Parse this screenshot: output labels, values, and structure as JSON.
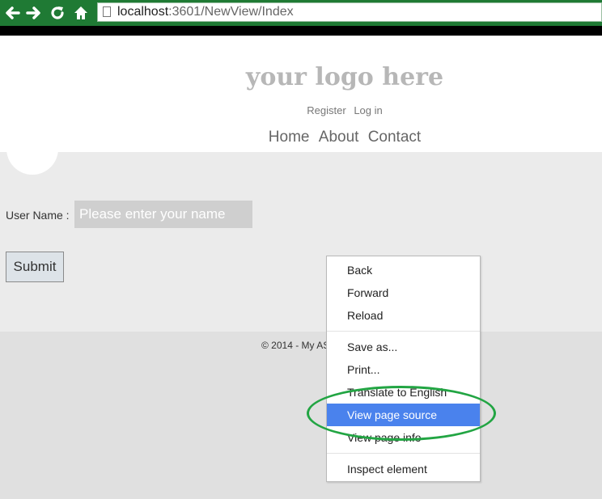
{
  "browser": {
    "address_host": "localhost",
    "address_rest": ":3601/NewView/Index",
    "icons": [
      "back-arrow-icon",
      "forward-arrow-icon",
      "reload-icon",
      "home-icon",
      "page-icon"
    ]
  },
  "header": {
    "logo": "your logo here",
    "auth": {
      "register": "Register",
      "login": "Log in"
    },
    "nav": [
      "Home",
      "About",
      "Contact"
    ]
  },
  "form": {
    "user_label": "User Name :",
    "name_placeholder": "Please enter your name",
    "submit": "Submit"
  },
  "footer": {
    "text": "© 2014 - My AS"
  },
  "context_menu": {
    "items": [
      {
        "label": "Back"
      },
      {
        "label": "Forward"
      },
      {
        "label": "Reload"
      },
      {
        "label": "Save as..."
      },
      {
        "label": "Print..."
      },
      {
        "label": "Translate to English"
      },
      {
        "label": "View page source",
        "highlighted": true
      },
      {
        "label": "View page info"
      },
      {
        "label": "Inspect element"
      }
    ]
  },
  "colors": {
    "highlight": "#4a82ed",
    "annotation_ellipse": "#22a543",
    "chrome": "#1f7a34"
  }
}
